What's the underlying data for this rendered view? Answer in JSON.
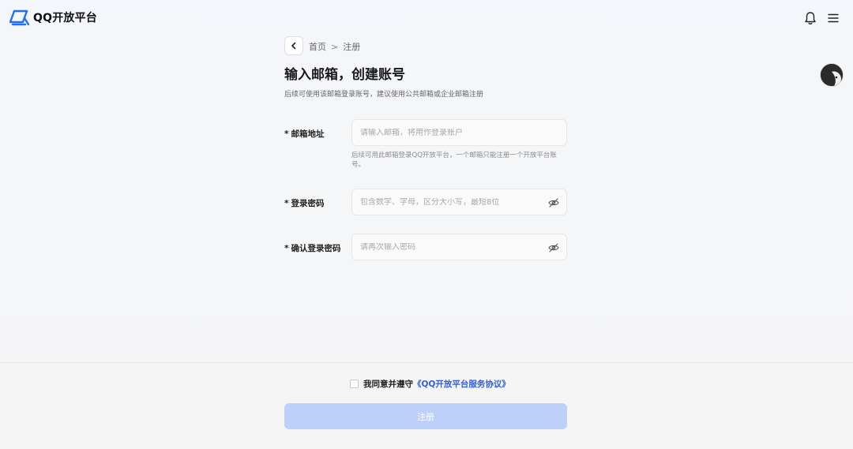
{
  "header": {
    "brand": "QQ开放平台",
    "icons": [
      "logo-icon",
      "bell-icon",
      "menu-icon"
    ]
  },
  "breadcrumb": {
    "home": "首页",
    "separator": ">",
    "current": "注册"
  },
  "page": {
    "title": "输入邮箱，创建账号",
    "subtitle": "后续可使用该邮箱登录账号，建议使用公共邮箱或企业邮箱注册"
  },
  "form": {
    "email": {
      "required_mark": "*",
      "label": "邮箱地址",
      "placeholder": "请输入邮箱，将用作登录账户",
      "value": "",
      "hint": "后续可用此邮箱登录QQ开放平台，一个邮箱只能注册一个开放平台账号。"
    },
    "password": {
      "required_mark": "*",
      "label": "登录密码",
      "placeholder": "包含数字、字母，区分大小写，最短8位",
      "value": ""
    },
    "confirm": {
      "required_mark": "*",
      "label": "确认登录密码",
      "placeholder": "请再次输入密码",
      "value": ""
    }
  },
  "footer": {
    "agree_text": "我同意并遵守",
    "agree_link": "《QQ开放平台服务协议》",
    "submit_label": "注册",
    "checked": false
  },
  "colors": {
    "accent": "#2f5fdc",
    "button_disabled": "#bdd0fa",
    "logo_blue": "#1e6fff"
  }
}
